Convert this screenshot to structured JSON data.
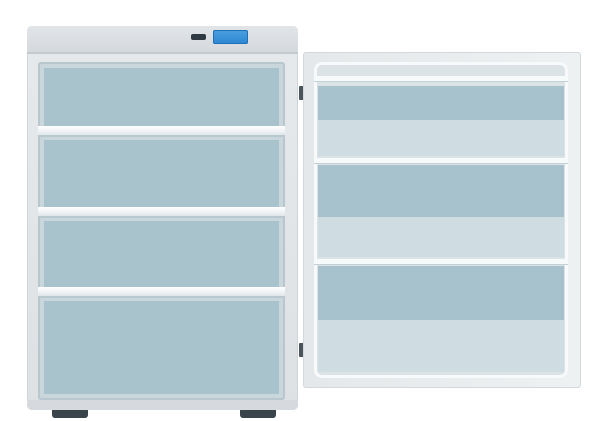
{
  "scene": {
    "subject": "fridge-icon",
    "colors": {
      "body": "#e7eaec",
      "interior": "#a9c3cd",
      "shelf": "#ffffff",
      "display": "#2c86d2",
      "feet": "#3a444b",
      "door_band_light": "#cfdde3"
    },
    "cabinet_shelf_count": 3,
    "door_rail_count": 3,
    "door_state": "open"
  }
}
